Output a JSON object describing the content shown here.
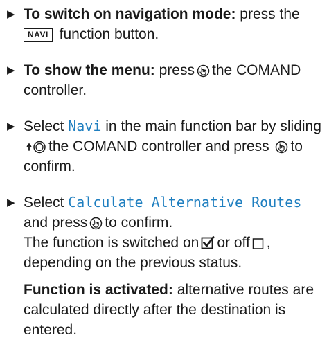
{
  "step1": {
    "bold": "To switch on navigation mode:",
    "pre": "press the",
    "key": "NAVI",
    "post": "function button."
  },
  "step2": {
    "bold": "To show the menu:",
    "pre": "press",
    "post": "the COMAND controller."
  },
  "step3": {
    "pre": "Select",
    "mono": "Navi",
    "mid": "in the main function bar by sliding",
    "mid2": "the COMAND controller and press",
    "post": "to confirm."
  },
  "step4": {
    "pre": "Select",
    "mono": "Calculate Alternative Routes",
    "mid": "and press",
    "post": "to confirm.",
    "status_pre": "The function is switched on",
    "status_mid": "or off",
    "status_post": ", depending on the previous status.",
    "activated_bold": "Function is activated:",
    "activated_text": "alternative routes are calculated directly after the destination is entered."
  },
  "icons": {
    "bullet": "play-arrow-icon",
    "press": "controller-press-icon",
    "slide": "controller-slide-up-icon",
    "checked": "checkbox-checked-icon",
    "unchecked": "checkbox-empty-icon"
  }
}
